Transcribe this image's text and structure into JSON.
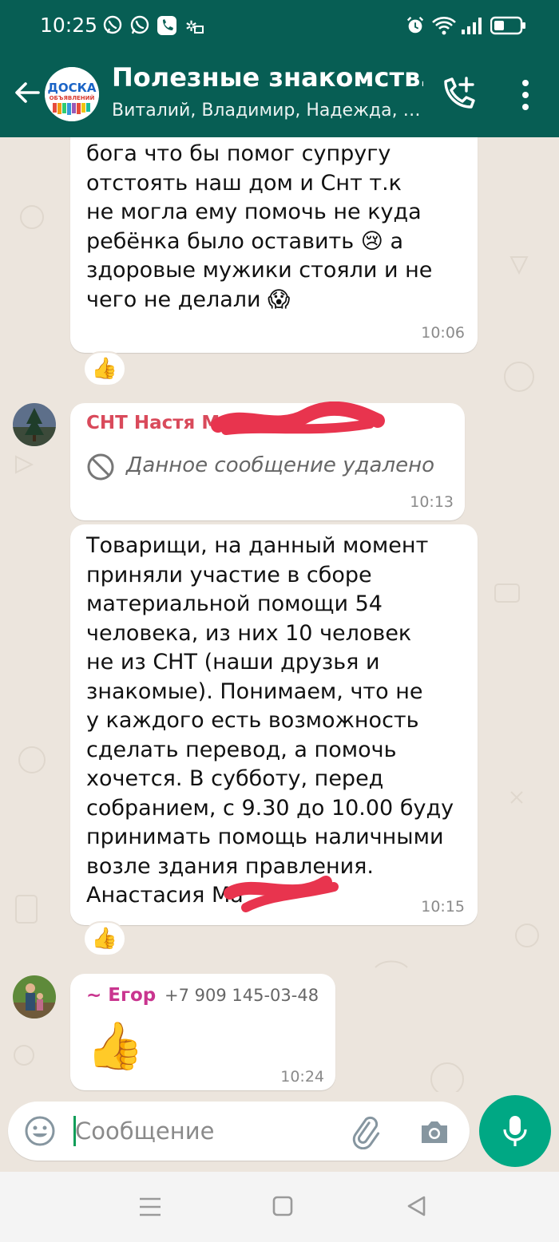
{
  "status_bar": {
    "time": "10:25",
    "left_icons": [
      "viber-icon",
      "whatsapp-icon",
      "phone-app-icon",
      "stars-icon"
    ],
    "right_icons": [
      "alarm-icon",
      "wifi-icon",
      "signal-icon",
      "battery-icon"
    ]
  },
  "header": {
    "group_name": "Полезные знакомств…",
    "participants": "Виталий, Владимир, Надежда, …",
    "avatar_text": [
      "ДОСКА",
      "ОБЪЯВЛЕНИЙ"
    ]
  },
  "messages": [
    {
      "text": "бога что бы помог супругу\nотстоять наш дом и Снт т.к\nне могла ему помочь не куда\nребёнка было оставить 😢 а\nздоровые мужики стояли и не\nчего не делали 😱",
      "time": "10:06",
      "reaction": "👍"
    },
    {
      "sender": "СНТ Настя М",
      "deleted_text": "Данное сообщение удалено",
      "time": "10:13"
    },
    {
      "text": "Товарищи, на данный момент\nприняли участие в сборе\nматериальной помощи 54\nчеловека, из них 10 человек\nне из СНТ (наши друзья и\nзнакомые). Понимаем, что не\nу каждого есть возможность\nсделать перевод, а помочь\nхочется. В субботу, перед\nсобранием, с 9.30 до 10.00 буду\nпринимать помощь наличными\nвозле здания правления.\nАнастасия Ма",
      "time": "10:15",
      "reaction": "👍"
    },
    {
      "sender": "~ Егор",
      "phone": "+7 909 145-03-48",
      "emoji": "👍",
      "time": "10:24"
    }
  ],
  "input": {
    "placeholder": "Сообщение"
  },
  "colors": {
    "header": "#075e54",
    "accent": "#00a884",
    "sender_red": "#d94a5b",
    "sender_pink": "#c9358f",
    "redaction": "#e8344e"
  }
}
